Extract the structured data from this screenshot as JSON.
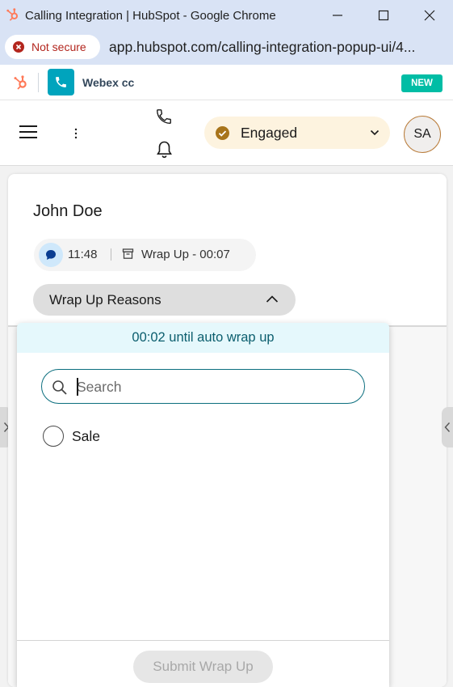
{
  "window": {
    "title": "Calling Integration | HubSpot - Google Chrome",
    "security_label": "Not secure",
    "url": "app.hubspot.com/calling-integration-popup-ui/4..."
  },
  "app_header": {
    "app_name": "Webex cc",
    "badge": "NEW"
  },
  "toolbar": {
    "agent_state": "Engaged",
    "avatar_initials": "SA"
  },
  "call": {
    "contact_name": "John Doe",
    "call_timer": "11:48",
    "wrap_label": "Wrap Up",
    "wrap_separator": "-",
    "wrap_timer": "00:07",
    "wrap_reasons_label": "Wrap Up Reasons"
  },
  "wrap_popover": {
    "auto_wrap_notice": "00:02 until auto wrap up",
    "search_placeholder": "Search",
    "options": [
      {
        "label": "Sale",
        "selected": false
      }
    ],
    "submit_label": "Submit Wrap Up"
  },
  "colors": {
    "chrome_bar": "#d9e3f5",
    "hubspot_orange": "#ff7a59",
    "call_tile": "#00a4bd",
    "new_badge": "#00bda5",
    "state_bg": "#fdf3df",
    "state_icon": "#a8741a",
    "accent_teal": "#0b6e7e",
    "notice_bg": "#e5f8fc"
  },
  "icons": {
    "hubspot": "hubspot-sprocket-icon",
    "phone": "phone-icon",
    "bell": "bell-icon",
    "menu": "hamburger-icon",
    "more": "more-vertical-icon",
    "state": "check-circle-icon",
    "search": "search-icon"
  }
}
